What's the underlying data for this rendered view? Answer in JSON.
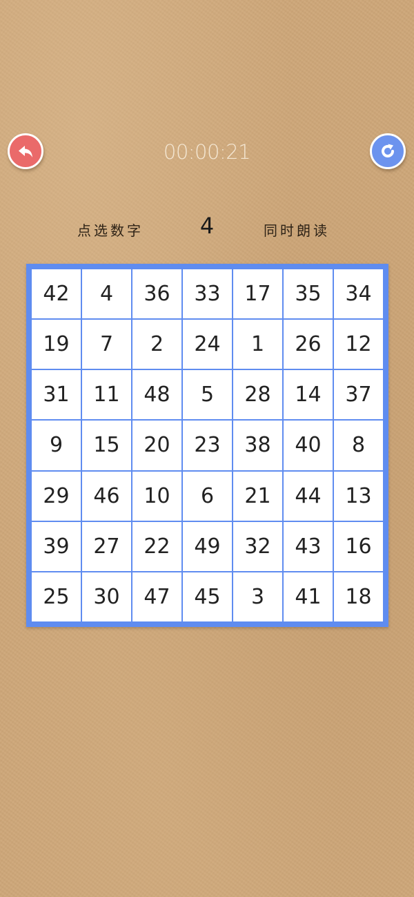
{
  "header": {
    "timer": "00:00:21",
    "back_icon": "undo-arrow-icon",
    "reset_icon": "refresh-icon"
  },
  "colors": {
    "back_button": "#ea6a6a",
    "reset_button": "#6c93ee",
    "grid_border": "#5f8cf0",
    "background": "#cda678"
  },
  "instruction": {
    "left": "点选数字",
    "target": "4",
    "right": "同时朗读"
  },
  "grid": {
    "rows": [
      [
        "42",
        "4",
        "36",
        "33",
        "17",
        "35",
        "34"
      ],
      [
        "19",
        "7",
        "2",
        "24",
        "1",
        "26",
        "12"
      ],
      [
        "31",
        "11",
        "48",
        "5",
        "28",
        "14",
        "37"
      ],
      [
        "9",
        "15",
        "20",
        "23",
        "38",
        "40",
        "8"
      ],
      [
        "29",
        "46",
        "10",
        "6",
        "21",
        "44",
        "13"
      ],
      [
        "39",
        "27",
        "22",
        "49",
        "32",
        "43",
        "16"
      ],
      [
        "25",
        "30",
        "47",
        "45",
        "3",
        "41",
        "18"
      ]
    ]
  }
}
